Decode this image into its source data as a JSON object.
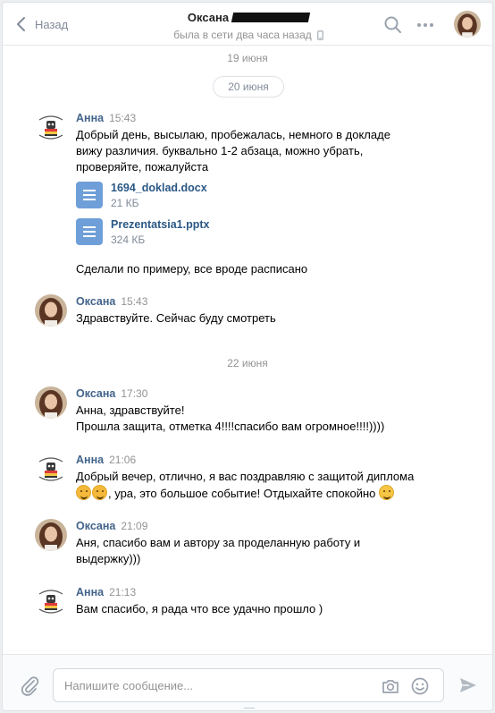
{
  "header": {
    "back_label": "Назад",
    "peer_name": "Оксана",
    "peer_status": "была в сети два часа назад"
  },
  "dates": {
    "prev": "19 июня",
    "jun20": "20 июня",
    "jun22": "22 июня"
  },
  "messages": [
    {
      "author": "Анна",
      "time": "15:43",
      "text": "Добрый день, высылаю, пробежалась, немного в докладе вижу различия. буквально 1-2 абзаца, можно убрать, проверяйте, пожалуйста",
      "docs": [
        {
          "name": "1694_doklad.docx",
          "size": "21 КБ"
        },
        {
          "name": "Prezentatsia1.pptx",
          "size": "324 КБ"
        }
      ],
      "text2": "Сделали по примеру, все вроде расписано"
    },
    {
      "author": "Оксана",
      "time": "15:43",
      "text": "Здравствуйте. Сейчас буду смотреть"
    },
    {
      "author": "Оксана",
      "time": "17:30",
      "line1": "Анна, здравствуйте!",
      "line2": "Прошла защита, отметка 4!!!!спасибо вам огромное!!!!))))"
    },
    {
      "author": "Анна",
      "time": "21:06",
      "line1": "Добрый вечер, отлично, я вас поздравляю с защитой диплома",
      "line2": ", ура, это большое событие! Отдыхайте спокойно"
    },
    {
      "author": "Оксана",
      "time": "21:09",
      "text": "Аня, спасибо вам и автору за проделанную работу и выдержку)))"
    },
    {
      "author": "Анна",
      "time": "21:13",
      "text": "Вам спасибо, я рада что все удачно прошло )"
    }
  ],
  "composer": {
    "placeholder": "Напишите сообщение..."
  },
  "colors": {
    "link": "#42648b",
    "file_icon": "#6f9fd8",
    "muted": "#939393"
  }
}
